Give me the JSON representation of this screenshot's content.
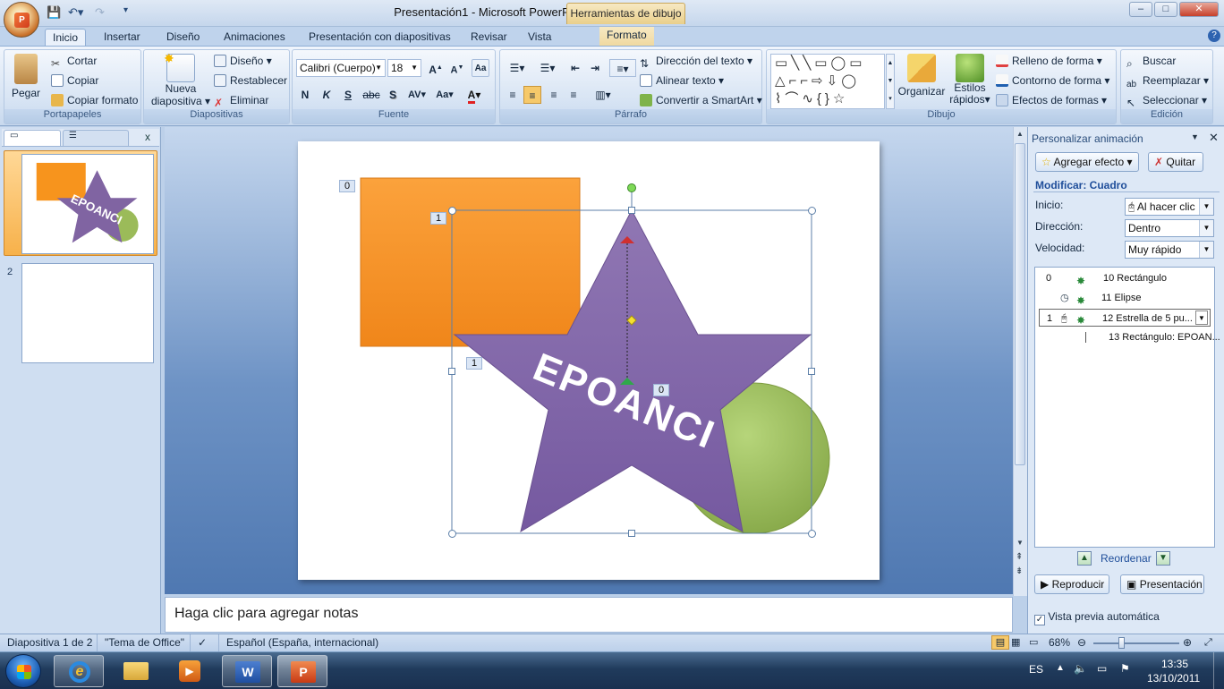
{
  "window": {
    "title": "Presentación1 - Microsoft PowerPoint",
    "contextual_tab": "Herramientas de dibujo",
    "min_label": "–",
    "max_label": "□",
    "close_label": "✕"
  },
  "tabs": [
    "Inicio",
    "Insertar",
    "Diseño",
    "Animaciones",
    "Presentación con diapositivas",
    "Revisar",
    "Vista",
    "Formato"
  ],
  "ribbon": {
    "portapapeles": {
      "label": "Portapapeles",
      "paste": "Pegar",
      "cut": "Cortar",
      "copy": "Copiar",
      "format_painter": "Copiar formato"
    },
    "diapositivas": {
      "label": "Diapositivas",
      "new_slide_1": "Nueva",
      "new_slide_2": "diapositiva",
      "layout": "Diseño",
      "reset": "Restablecer",
      "delete": "Eliminar"
    },
    "fuente": {
      "label": "Fuente",
      "font_name": "Calibri (Cuerpo)",
      "font_size": "18",
      "bold": "N",
      "italic": "K",
      "underline": "S",
      "strike": "abc",
      "shadow": "S",
      "spacing": "AV",
      "case": "Aa",
      "color": "A"
    },
    "parrafo": {
      "label": "Párrafo",
      "text_direction": "Dirección del texto",
      "align_text": "Alinear texto",
      "smartart": "Convertir a SmartArt"
    },
    "dibujo": {
      "label": "Dibujo",
      "arrange": "Organizar",
      "quick_styles_1": "Estilos",
      "quick_styles_2": "rápidos",
      "fill": "Relleno de forma",
      "outline": "Contorno de forma",
      "effects": "Efectos de formas"
    },
    "edicion": {
      "label": "Edición",
      "find": "Buscar",
      "replace": "Reemplazar",
      "select": "Seleccionar"
    }
  },
  "left_panel": {
    "slide_1_num": "1",
    "slide_2_num": "2",
    "thumb_text": "EPOANCI",
    "close": "x"
  },
  "slide": {
    "star_text": "EPOANCI",
    "tag_rect": "0",
    "tag_star": "1",
    "tag_star2": "1",
    "tag_ellipse": "0"
  },
  "notes_placeholder": "Haga clic para agregar notas",
  "task_pane": {
    "title": "Personalizar animación",
    "add_effect": "Agregar efecto",
    "remove": "Quitar",
    "modify": "Modificar: Cuadro",
    "start_label": "Inicio:",
    "start_value": "Al hacer clic",
    "direction_label": "Dirección:",
    "direction_value": "Dentro",
    "speed_label": "Velocidad:",
    "speed_value": "Muy rápido",
    "items": [
      {
        "num": "0",
        "name": "10 Rectángulo"
      },
      {
        "num": "",
        "name": "11 Elipse"
      },
      {
        "num": "1",
        "name": "12 Estrella de 5 pu..."
      },
      {
        "num": "",
        "name": "13 Rectángulo: EPOAN..."
      }
    ],
    "reorder": "Reordenar",
    "play": "Reproducir",
    "slideshow": "Presentación",
    "autopreview": "Vista previa automática"
  },
  "status": {
    "slide_info": "Diapositiva 1 de 2",
    "theme": "\"Tema de Office\"",
    "language": "Español (España, internacional)",
    "zoom": "68%"
  },
  "taskbar": {
    "lang": "ES",
    "time": "13:35",
    "date": "13/10/2011"
  },
  "colors": {
    "orange": "#f7941d",
    "purple": "#8064a2",
    "green": "#9bbb59",
    "accent_blue": "#1f4e9a"
  }
}
